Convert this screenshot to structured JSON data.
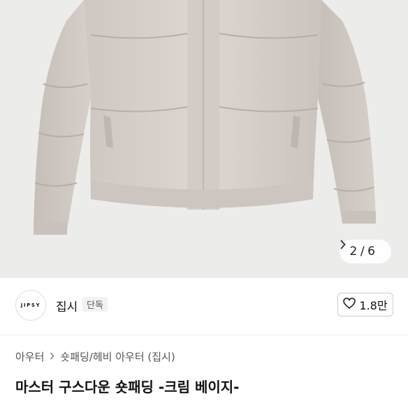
{
  "gallery": {
    "current": "2",
    "separator": "/",
    "total": "6",
    "next_icon": "chevron-right-icon",
    "background_color": "#ececea",
    "jacket_color": "#d8d1cc"
  },
  "brand": {
    "logo_text": "JIPSY",
    "name": "집시",
    "badge": "단독"
  },
  "like": {
    "icon": "heart-outline-icon",
    "count": "1.8만"
  },
  "breadcrumb": {
    "items": [
      "아우터",
      "숏패딩/헤비 아우터 (집시)"
    ],
    "separator_icon": "chevron-right-icon"
  },
  "product": {
    "title": "마스터 구스다운 숏패딩 -크림 베이지-"
  }
}
